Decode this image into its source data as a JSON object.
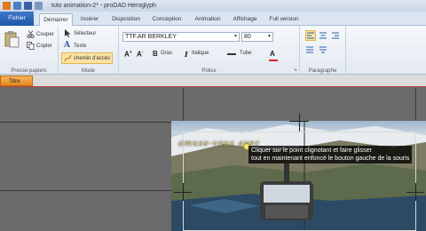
{
  "window": {
    "title": "tuto animation-2* - proDAD Heroglyph"
  },
  "tabs": {
    "fichier": "Fichier",
    "demarrer": "Démarrer",
    "inserer": "Insérer",
    "disposition": "Disposition",
    "conception": "Conception",
    "animation": "Animation",
    "affichage": "Affichage",
    "full_version": "Full version"
  },
  "ribbon": {
    "clipboard": {
      "couper": "Couper",
      "copier": "Copier",
      "label": "Presse-papiers"
    },
    "mode": {
      "selecteur": "Sélecteur",
      "texte": "Texte",
      "chemin": "chemin d'accès",
      "label": "Mode"
    },
    "police": {
      "font_name": "TTF.AR BERKLEY",
      "font_size": "80",
      "gras": "Gras",
      "italique": "Italique",
      "tube": "Tube",
      "label": "Police"
    },
    "paragraphe": {
      "label": "Paragraphe"
    }
  },
  "timeline": {
    "track_name": "Titre"
  },
  "canvas": {
    "title_text": "amuse-vous avec",
    "tooltip_line1": "Cliquer sur le point clignotant et faire glisser",
    "tooltip_line2": "tout en maintenant enfoncé le bouton gauche de la souris"
  },
  "colors": {
    "accent": "#e58a1a",
    "ribbon_bg": "#e3e9f2",
    "fichier_tab": "#1f57a8",
    "workspace": "#6b6b6b"
  }
}
